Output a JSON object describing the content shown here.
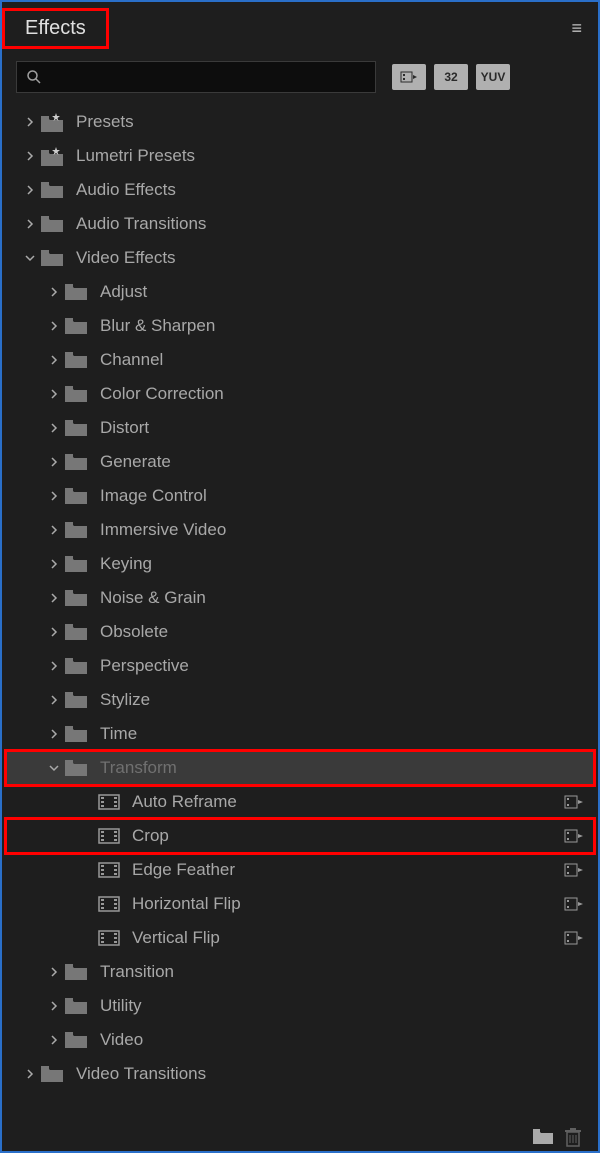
{
  "panel": {
    "title": "Effects",
    "search_value": ""
  },
  "toolbar_badges": [
    "",
    "32",
    "YUV"
  ],
  "tree": [
    {
      "id": "presets",
      "label": "Presets",
      "depth": 0,
      "expanded": false,
      "icon": "preset",
      "has_children": true,
      "accel": false
    },
    {
      "id": "lumetri",
      "label": "Lumetri Presets",
      "depth": 0,
      "expanded": false,
      "icon": "preset",
      "has_children": true,
      "accel": false
    },
    {
      "id": "audio-effects",
      "label": "Audio Effects",
      "depth": 0,
      "expanded": false,
      "icon": "folder",
      "has_children": true,
      "accel": false
    },
    {
      "id": "audio-transitions",
      "label": "Audio Transitions",
      "depth": 0,
      "expanded": false,
      "icon": "folder",
      "has_children": true,
      "accel": false
    },
    {
      "id": "video-effects",
      "label": "Video Effects",
      "depth": 0,
      "expanded": true,
      "icon": "folder",
      "has_children": true,
      "accel": false
    },
    {
      "id": "adjust",
      "label": "Adjust",
      "depth": 1,
      "expanded": false,
      "icon": "folder",
      "has_children": true,
      "accel": false
    },
    {
      "id": "blur",
      "label": "Blur & Sharpen",
      "depth": 1,
      "expanded": false,
      "icon": "folder",
      "has_children": true,
      "accel": false
    },
    {
      "id": "channel",
      "label": "Channel",
      "depth": 1,
      "expanded": false,
      "icon": "folder",
      "has_children": true,
      "accel": false
    },
    {
      "id": "color-correction",
      "label": "Color Correction",
      "depth": 1,
      "expanded": false,
      "icon": "folder",
      "has_children": true,
      "accel": false
    },
    {
      "id": "distort",
      "label": "Distort",
      "depth": 1,
      "expanded": false,
      "icon": "folder",
      "has_children": true,
      "accel": false
    },
    {
      "id": "generate",
      "label": "Generate",
      "depth": 1,
      "expanded": false,
      "icon": "folder",
      "has_children": true,
      "accel": false
    },
    {
      "id": "image-control",
      "label": "Image Control",
      "depth": 1,
      "expanded": false,
      "icon": "folder",
      "has_children": true,
      "accel": false
    },
    {
      "id": "immersive",
      "label": "Immersive Video",
      "depth": 1,
      "expanded": false,
      "icon": "folder",
      "has_children": true,
      "accel": false
    },
    {
      "id": "keying",
      "label": "Keying",
      "depth": 1,
      "expanded": false,
      "icon": "folder",
      "has_children": true,
      "accel": false
    },
    {
      "id": "noise",
      "label": "Noise & Grain",
      "depth": 1,
      "expanded": false,
      "icon": "folder",
      "has_children": true,
      "accel": false
    },
    {
      "id": "obsolete",
      "label": "Obsolete",
      "depth": 1,
      "expanded": false,
      "icon": "folder",
      "has_children": true,
      "accel": false
    },
    {
      "id": "perspective",
      "label": "Perspective",
      "depth": 1,
      "expanded": false,
      "icon": "folder",
      "has_children": true,
      "accel": false
    },
    {
      "id": "stylize",
      "label": "Stylize",
      "depth": 1,
      "expanded": false,
      "icon": "folder",
      "has_children": true,
      "accel": false
    },
    {
      "id": "time",
      "label": "Time",
      "depth": 1,
      "expanded": false,
      "icon": "folder",
      "has_children": true,
      "accel": false
    },
    {
      "id": "transform",
      "label": "Transform",
      "depth": 1,
      "expanded": true,
      "icon": "folder",
      "has_children": true,
      "accel": false,
      "selected": true,
      "highlighted": true,
      "dimmed": true
    },
    {
      "id": "auto-reframe",
      "label": "Auto Reframe",
      "depth": 2,
      "icon": "effect",
      "has_children": false,
      "accel": true
    },
    {
      "id": "crop",
      "label": "Crop",
      "depth": 2,
      "icon": "effect",
      "has_children": false,
      "accel": true,
      "highlighted": true
    },
    {
      "id": "edge-feather",
      "label": "Edge Feather",
      "depth": 2,
      "icon": "effect",
      "has_children": false,
      "accel": true
    },
    {
      "id": "horizontal-flip",
      "label": "Horizontal Flip",
      "depth": 2,
      "icon": "effect",
      "has_children": false,
      "accel": true
    },
    {
      "id": "vertical-flip",
      "label": "Vertical Flip",
      "depth": 2,
      "icon": "effect",
      "has_children": false,
      "accel": true
    },
    {
      "id": "transition",
      "label": "Transition",
      "depth": 1,
      "expanded": false,
      "icon": "folder",
      "has_children": true,
      "accel": false
    },
    {
      "id": "utility",
      "label": "Utility",
      "depth": 1,
      "expanded": false,
      "icon": "folder",
      "has_children": true,
      "accel": false
    },
    {
      "id": "video",
      "label": "Video",
      "depth": 1,
      "expanded": false,
      "icon": "folder",
      "has_children": true,
      "accel": false
    },
    {
      "id": "video-transitions",
      "label": "Video Transitions",
      "depth": 0,
      "expanded": false,
      "icon": "folder",
      "has_children": true,
      "accel": false
    }
  ]
}
